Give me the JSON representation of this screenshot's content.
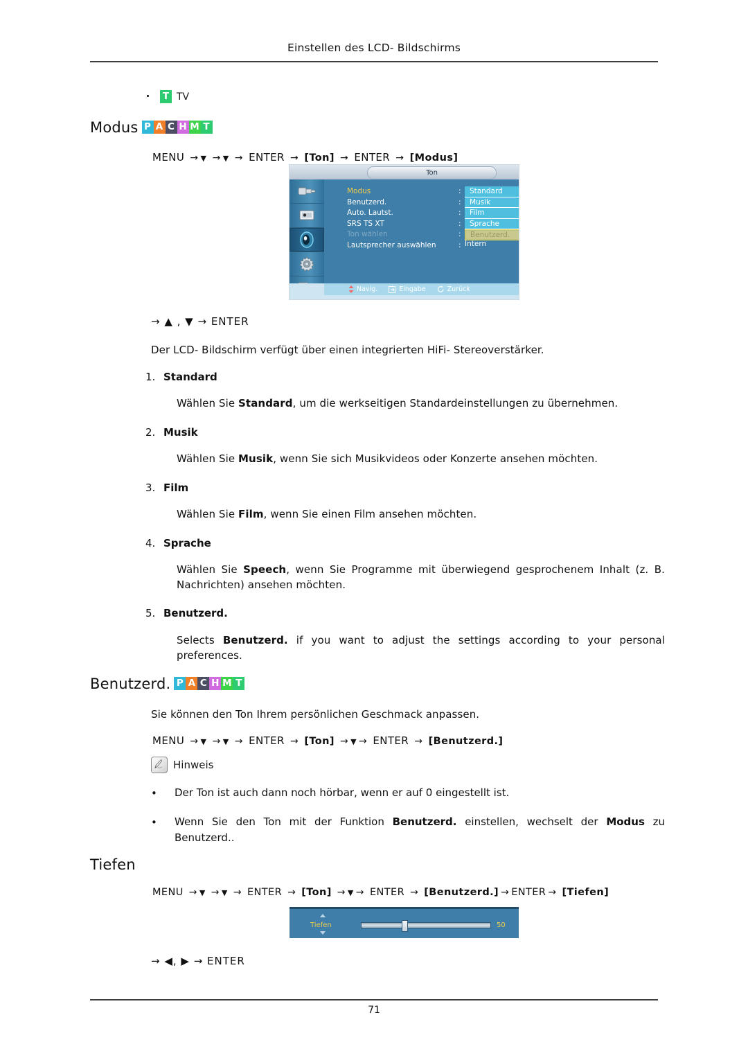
{
  "header": {
    "running_title": "Einstellen des LCD- Bildschirms"
  },
  "footer": {
    "page_number": "71"
  },
  "tv_line": {
    "badge_label": "T",
    "badge_color": "#2ecc71",
    "text": "TV"
  },
  "badges_pachmt": [
    {
      "letter": "P",
      "color": "#2fb8d8"
    },
    {
      "letter": "A",
      "color": "#f07f28"
    },
    {
      "letter": "C",
      "color": "#4c4f63"
    },
    {
      "letter": "H",
      "color": "#d06ce0"
    },
    {
      "letter": "M",
      "color": "#3ed44a"
    },
    {
      "letter": "T",
      "color": "#2ecc71"
    }
  ],
  "sections": {
    "modus": {
      "title": "Modus",
      "menu_path": {
        "start": "MENU",
        "enter1": "ENTER",
        "bracket1": "[Ton]",
        "enter2": "ENTER",
        "bracket2": "[Modus]"
      },
      "nav_line": "→ ▲ , ▼ → ENTER",
      "intro": "Der LCD- Bildschirm verfügt über einen integrierten HiFi- Stereoverstärker.",
      "items": [
        {
          "num": "1.",
          "name": "Standard",
          "desc_pre": "Wählen Sie ",
          "desc_bold": "Standard",
          "desc_post": ", um die werkseitigen Standardeinstellungen zu übernehmen."
        },
        {
          "num": "2.",
          "name": "Musik",
          "desc_pre": "Wählen Sie ",
          "desc_bold": "Musik",
          "desc_post": ", wenn Sie sich Musikvideos oder Konzerte ansehen möchten."
        },
        {
          "num": "3.",
          "name": "Film",
          "desc_pre": "Wählen Sie ",
          "desc_bold": "Film",
          "desc_post": ", wenn Sie einen Film ansehen möchten."
        },
        {
          "num": "4.",
          "name": "Sprache",
          "desc_pre": "Wählen Sie ",
          "desc_bold": "Speech",
          "desc_post": ", wenn Sie Programme mit  überwiegend gesprochenem Inhalt (z. B. Nachrichten) ansehen möchten."
        },
        {
          "num": "5.",
          "name": "Benutzerd.",
          "desc_pre": "Selects ",
          "desc_bold": "Benutzerd.",
          "desc_post": " if you want to adjust the settings according to your personal preferences."
        }
      ]
    },
    "benutzerd": {
      "title": "Benutzerd.",
      "intro": "Sie können den Ton Ihrem persönlichen Geschmack anpassen.",
      "menu_path": {
        "start": "MENU",
        "enter1": "ENTER",
        "bracket1": "[Ton]",
        "enter2": "ENTER",
        "bracket2": "[Benutzerd.]"
      },
      "note_label": "Hinweis",
      "note_icon": "note-pen-icon",
      "notes": [
        {
          "pre": "Der Ton ist auch dann noch hörbar, wenn er auf 0 eingestellt ist.",
          "bold1": "",
          "mid": "",
          "bold2": "",
          "post": ""
        },
        {
          "pre": "Wenn Sie den Ton mit der Funktion ",
          "bold1": "Benutzerd.",
          "mid": " einstellen, wechselt der ",
          "bold2": "Modus",
          "post": " zu Benutzerd.."
        }
      ]
    },
    "tiefen": {
      "title": "Tiefen",
      "menu_path": {
        "start": "MENU",
        "enter1": "ENTER",
        "bracket1": "[Ton]",
        "enter2": "ENTER",
        "bracket2": "[Benutzerd.]",
        "enter3": "ENTER",
        "bracket3": "[Tiefen]"
      },
      "nav_line": "→ ◀, ▶ → ENTER"
    }
  },
  "osd_menu": {
    "title": "Ton",
    "sidebar_icons": [
      {
        "name": "input-plug-icon",
        "selected": false
      },
      {
        "name": "picture-display-icon",
        "selected": false
      },
      {
        "name": "sound-speaker-icon",
        "selected": true
      },
      {
        "name": "setup-gear-icon",
        "selected": false
      },
      {
        "name": "multi-control-pages-icon",
        "selected": false
      }
    ],
    "rows": [
      {
        "label": "Modus",
        "state": "active"
      },
      {
        "label": "Benutzerd.",
        "state": "normal"
      },
      {
        "label": "Auto. Lautst.",
        "state": "normal"
      },
      {
        "label": "SRS TS XT",
        "state": "normal"
      },
      {
        "label": "Ton wählen",
        "state": "dim"
      },
      {
        "label": "Lautsprecher auswählen",
        "state": "normal"
      }
    ],
    "values": [
      {
        "text": "Standard",
        "highlighted": false
      },
      {
        "text": "Musik",
        "highlighted": false
      },
      {
        "text": "Film",
        "highlighted": false
      },
      {
        "text": "Sprache",
        "highlighted": false
      },
      {
        "text": "Benutzerd.",
        "highlighted": true
      }
    ],
    "speaker_value": "Intern",
    "footer": {
      "navigate": "Navig.",
      "enter": "Eingabe",
      "return": "Zurück"
    },
    "colors": {
      "background": "#3f7ea8",
      "value_fill": "#4fbfe0",
      "highlight_border": "#e0d45a",
      "active_label": "#f2cd4a"
    }
  },
  "osd_slider": {
    "label": "Tiefen",
    "value": "50",
    "percent": 50
  }
}
